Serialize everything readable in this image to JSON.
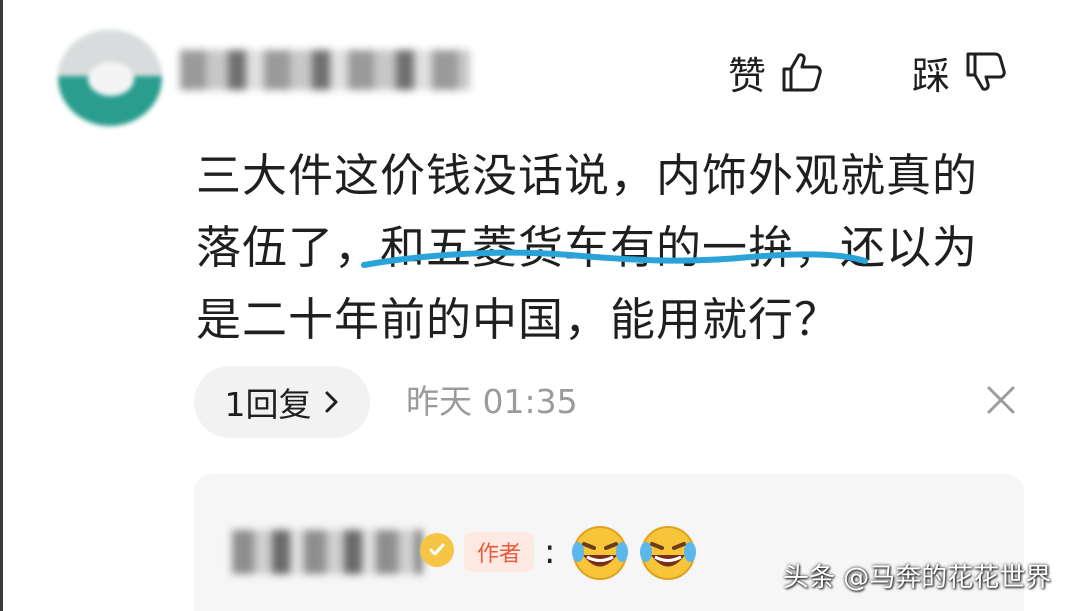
{
  "comment": {
    "like_label": "赞",
    "dislike_label": "踩",
    "text_line1": "三大件这价钱没话说，内饰外观就真的",
    "text_line2": "落伍了，和五菱货车有的一拚，还以为",
    "text_line3": "是二十年前的中国，能用就行？",
    "reply_count_label": "1回复",
    "timestamp": "昨天  01:35"
  },
  "reply": {
    "author_tag": "作者",
    "colon": ":"
  },
  "watermark": "头条 @马奔的花花世界",
  "colors": {
    "underline": "#2aa3d8",
    "author_tag_bg": "#fde9e2",
    "author_tag_text": "#e9593a",
    "badge": "#f6c545",
    "meta_gray": "#9b9b9b"
  }
}
